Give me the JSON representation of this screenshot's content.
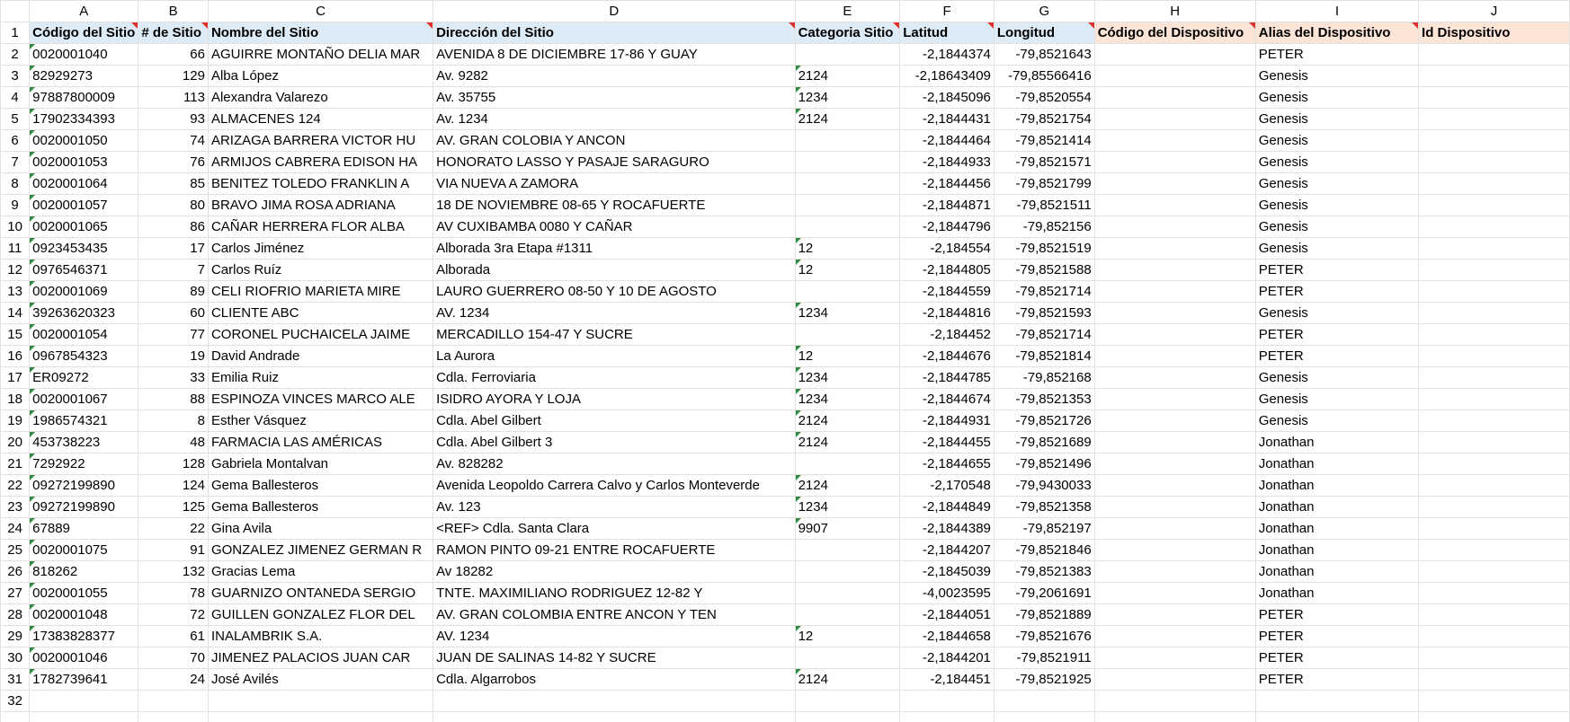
{
  "colors": {
    "header_blue": "#ddebf7",
    "header_orange": "#fce4d6",
    "comment_red": "#e03030",
    "error_green": "#2e8b3e"
  },
  "column_letters": [
    "A",
    "B",
    "C",
    "D",
    "E",
    "F",
    "G",
    "H",
    "I",
    "J"
  ],
  "header_row": {
    "row_number": "1",
    "cells": [
      "Código del Sitio",
      "# de Sitio",
      "Nombre del Sitio",
      "Dirección del Sitio",
      "Categoria Sitio",
      "Latitud",
      "Longitud",
      "Código del Dispositivo",
      "Alias del Dispositivo",
      "Id Dispositivo"
    ]
  },
  "rows": [
    {
      "n": "2",
      "cells": [
        "0020001040",
        "66",
        "AGUIRRE MONTAÑO DELIA MAR",
        "AVENIDA 8 DE DICIEMBRE 17-86 Y GUAY",
        "",
        "-2,1844374",
        "-79,8521643",
        "",
        "PETER",
        ""
      ]
    },
    {
      "n": "3",
      "cells": [
        "82929273",
        "129",
        "Alba López",
        "Av. 9282",
        "2124",
        "-2,18643409",
        "-79,85566416",
        "",
        "Genesis",
        ""
      ]
    },
    {
      "n": "4",
      "cells": [
        "97887800009",
        "113",
        "Alexandra Valarezo",
        "Av. 35755",
        "1234",
        "-2,1845096",
        "-79,8520554",
        "",
        "Genesis",
        ""
      ]
    },
    {
      "n": "5",
      "cells": [
        "17902334393",
        "93",
        "ALMACENES 124",
        "Av. 1234",
        "2124",
        "-2,1844431",
        "-79,8521754",
        "",
        "Genesis",
        ""
      ]
    },
    {
      "n": "6",
      "cells": [
        "0020001050",
        "74",
        "ARIZAGA BARRERA VICTOR HU",
        "AV. GRAN COLOBIA Y ANCON",
        "",
        "-2,1844464",
        "-79,8521414",
        "",
        "Genesis",
        ""
      ]
    },
    {
      "n": "7",
      "cells": [
        "0020001053",
        "76",
        "ARMIJOS CABRERA EDISON HA",
        "HONORATO LASSO Y PASAJE SARAGURO",
        "",
        "-2,1844933",
        "-79,8521571",
        "",
        "Genesis",
        ""
      ]
    },
    {
      "n": "8",
      "cells": [
        "0020001064",
        "85",
        "BENITEZ TOLEDO FRANKLIN A",
        "VIA NUEVA A ZAMORA",
        "",
        "-2,1844456",
        "-79,8521799",
        "",
        "Genesis",
        ""
      ]
    },
    {
      "n": "9",
      "cells": [
        "0020001057",
        "80",
        "BRAVO JIMA ROSA ADRIANA",
        "18 DE NOVIEMBRE 08-65 Y ROCAFUERTE",
        "",
        "-2,1844871",
        "-79,8521511",
        "",
        "Genesis",
        ""
      ]
    },
    {
      "n": "10",
      "cells": [
        "0020001065",
        "86",
        "CAÑAR HERRERA FLOR ALBA",
        "AV CUXIBAMBA 0080 Y CAÑAR",
        "",
        "-2,1844796",
        "-79,852156",
        "",
        "Genesis",
        ""
      ]
    },
    {
      "n": "11",
      "cells": [
        "0923453435",
        "17",
        "Carlos Jiménez",
        "Alborada 3ra Etapa #1311",
        "12",
        "-2,184554",
        "-79,8521519",
        "",
        "Genesis",
        ""
      ]
    },
    {
      "n": "12",
      "cells": [
        "0976546371",
        "7",
        "Carlos Ruíz",
        "Alborada",
        "12",
        "-2,1844805",
        "-79,8521588",
        "",
        "PETER",
        ""
      ]
    },
    {
      "n": "13",
      "cells": [
        "0020001069",
        "89",
        "CELI RIOFRIO MARIETA MIRE",
        "LAURO GUERRERO 08-50 Y 10 DE AGOSTO",
        "",
        "-2,1844559",
        "-79,8521714",
        "",
        "PETER",
        ""
      ]
    },
    {
      "n": "14",
      "cells": [
        "39263620323",
        "60",
        "CLIENTE ABC",
        "AV. 1234",
        "1234",
        "-2,1844816",
        "-79,8521593",
        "",
        "Genesis",
        ""
      ]
    },
    {
      "n": "15",
      "cells": [
        "0020001054",
        "77",
        "CORONEL PUCHAICELA JAIME",
        "MERCADILLO 154-47 Y SUCRE",
        "",
        "-2,184452",
        "-79,8521714",
        "",
        "PETER",
        ""
      ]
    },
    {
      "n": "16",
      "cells": [
        "0967854323",
        "19",
        "David Andrade",
        "La Aurora",
        "12",
        "-2,1844676",
        "-79,8521814",
        "",
        "PETER",
        ""
      ]
    },
    {
      "n": "17",
      "cells": [
        "ER09272",
        "33",
        "Emilia Ruiz",
        "Cdla. Ferroviaria",
        "1234",
        "-2,1844785",
        "-79,852168",
        "",
        "Genesis",
        ""
      ]
    },
    {
      "n": "18",
      "cells": [
        "0020001067",
        "88",
        "ESPINOZA VINCES MARCO ALE",
        "ISIDRO AYORA Y LOJA",
        "1234",
        "-2,1844674",
        "-79,8521353",
        "",
        "Genesis",
        ""
      ]
    },
    {
      "n": "19",
      "cells": [
        "1986574321",
        "8",
        "Esther Vásquez",
        "Cdla. Abel Gilbert",
        "2124",
        "-2,1844931",
        "-79,8521726",
        "",
        "Genesis",
        ""
      ]
    },
    {
      "n": "20",
      "cells": [
        "453738223",
        "48",
        "FARMACIA LAS AMÉRICAS",
        "Cdla. Abel Gilbert 3",
        "2124",
        "-2,1844455",
        "-79,8521689",
        "",
        "Jonathan",
        ""
      ]
    },
    {
      "n": "21",
      "cells": [
        "7292922",
        "128",
        "Gabriela Montalvan",
        "Av. 828282",
        "",
        "-2,1844655",
        "-79,8521496",
        "",
        "Jonathan",
        ""
      ]
    },
    {
      "n": "22",
      "cells": [
        "09272199890",
        "124",
        "Gema Ballesteros",
        "Avenida Leopoldo Carrera Calvo y Carlos Monteverde",
        "2124",
        "-2,170548",
        "-79,9430033",
        "",
        "Jonathan",
        ""
      ]
    },
    {
      "n": "23",
      "cells": [
        "09272199890",
        "125",
        "Gema Ballesteros",
        "Av. 123",
        "1234",
        "-2,1844849",
        "-79,8521358",
        "",
        "Jonathan",
        ""
      ]
    },
    {
      "n": "24",
      "cells": [
        "67889",
        "22",
        "Gina Avila",
        "<REF> Cdla. Santa Clara",
        "9907",
        "-2,1844389",
        "-79,852197",
        "",
        "Jonathan",
        ""
      ]
    },
    {
      "n": "25",
      "cells": [
        "0020001075",
        "91",
        "GONZALEZ JIMENEZ GERMAN R",
        "RAMON PINTO 09-21 ENTRE ROCAFUERTE",
        "",
        "-2,1844207",
        "-79,8521846",
        "",
        "Jonathan",
        ""
      ]
    },
    {
      "n": "26",
      "cells": [
        "818262",
        "132",
        "Gracias Lema",
        "Av 18282",
        "",
        "-2,1845039",
        "-79,8521383",
        "",
        "Jonathan",
        ""
      ]
    },
    {
      "n": "27",
      "cells": [
        "0020001055",
        "78",
        "GUARNIZO ONTANEDA SERGIO",
        "TNTE. MAXIMILIANO RODRIGUEZ 12-82 Y",
        "",
        "-4,0023595",
        "-79,2061691",
        "",
        "Jonathan",
        ""
      ]
    },
    {
      "n": "28",
      "cells": [
        "0020001048",
        "72",
        "GUILLEN GONZALEZ FLOR DEL",
        "AV. GRAN COLOMBIA ENTRE ANCON Y TEN",
        "",
        "-2,1844051",
        "-79,8521889",
        "",
        "PETER",
        ""
      ]
    },
    {
      "n": "29",
      "cells": [
        "17383828377",
        "61",
        "INALAMBRIK S.A.",
        "AV. 1234",
        "12",
        "-2,1844658",
        "-79,8521676",
        "",
        "PETER",
        ""
      ]
    },
    {
      "n": "30",
      "cells": [
        "0020001046",
        "70",
        "JIMENEZ PALACIOS JUAN CAR",
        "JUAN DE SALINAS 14-82 Y SUCRE",
        "",
        "-2,1844201",
        "-79,8521911",
        "",
        "PETER",
        ""
      ]
    },
    {
      "n": "31",
      "cells": [
        "1782739641",
        "24",
        "José Avilés",
        "Cdla. Algarrobos",
        "2124",
        "-2,184451",
        "-79,8521925",
        "",
        "PETER",
        ""
      ]
    },
    {
      "n": "32",
      "cells": [
        "",
        "",
        "",
        "",
        "",
        "",
        "",
        "",
        "",
        ""
      ]
    },
    {
      "n": "",
      "cells": [
        "",
        "",
        "",
        "",
        "",
        "",
        "",
        "",
        "",
        ""
      ]
    }
  ]
}
